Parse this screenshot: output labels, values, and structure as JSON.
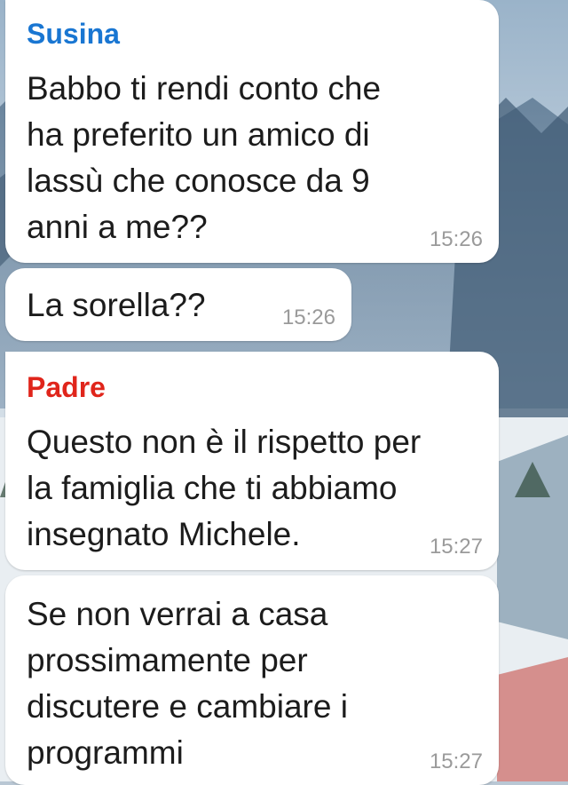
{
  "messages": [
    {
      "sender": "Susina",
      "sender_color": "#1976d2",
      "text": "Babbo ti rendi conto che\nha preferito un amico di\nlassù che conosce da 9\nanni a me??",
      "time": "15:26"
    },
    {
      "text": "La sorella??",
      "time": "15:26"
    },
    {
      "sender": "Padre",
      "sender_color": "#e0251b",
      "text": "Questo non è il rispetto per\nla famiglia che ti abbiamo\ninsegnato Michele.",
      "time": "15:27"
    },
    {
      "text": "Se non verrai a casa\nprossimamente per\ndiscutere e cambiare i\nprogrammi",
      "time": "15:27"
    }
  ]
}
